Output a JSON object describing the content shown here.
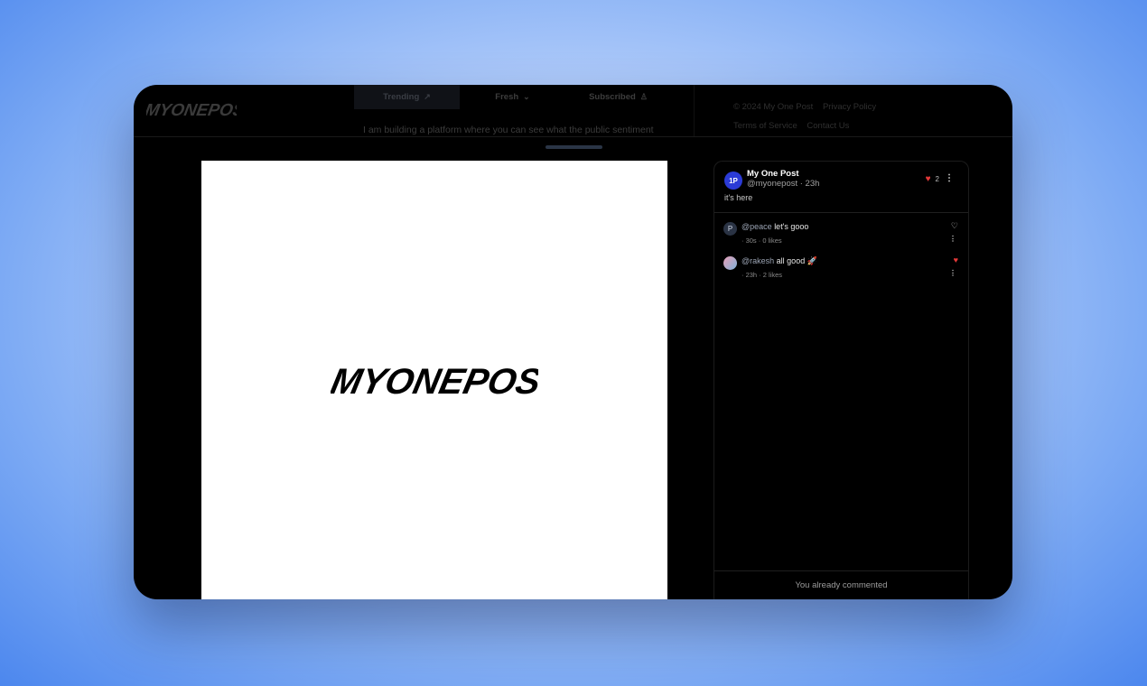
{
  "header": {
    "logo_alt": "MYONEPOST",
    "tabs": [
      {
        "label": "Trending",
        "icon": "trending-icon"
      },
      {
        "label": "Fresh",
        "icon": "chevron-down-double-icon"
      },
      {
        "label": "Subscribed",
        "icon": "user-icon"
      }
    ],
    "tagline": "I am building a platform where you can see what the public sentiment",
    "footer": {
      "copyright": "© 2024 My One Post",
      "privacy": "Privacy Policy",
      "terms": "Terms of Service",
      "contact": "Contact Us"
    }
  },
  "image": {
    "logo_text": "MYONEPOST"
  },
  "post": {
    "avatar_text": "1P",
    "author": "My One Post",
    "meta": "@myonepost · 23h",
    "text": "it's here",
    "like_count": "2"
  },
  "comments": [
    {
      "avatar": "P",
      "user": "@peace",
      "text": "let's gooo",
      "time": "· 30s",
      "likes": "· 0 likes",
      "liked": false
    },
    {
      "avatar": "",
      "user": "@rakesh",
      "text": "all good 🚀",
      "time": "· 23h",
      "likes": "· 2 likes",
      "liked": true
    }
  ],
  "status": {
    "already_commented": "You already commented"
  },
  "colors": {
    "accent": "#2b3bd6",
    "like": "#e53939"
  }
}
